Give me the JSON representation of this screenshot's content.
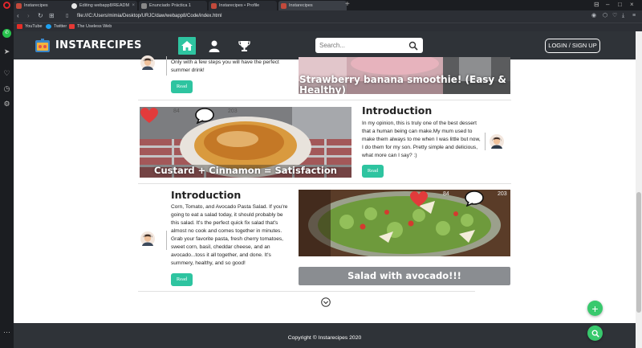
{
  "browser": {
    "tabs": [
      {
        "title": "Instarecipes"
      },
      {
        "title": "Editing webapp8/READMI"
      },
      {
        "title": "Enunciado Práctica 1"
      },
      {
        "title": "Instarecipes • Profile"
      },
      {
        "title": "Instarecipes"
      }
    ],
    "url": "file:///C:/Users/mimia/Desktop/URJC/daw/webapp8/Code/index.html",
    "bookmarks": [
      "YouTube",
      "Twitter",
      "The Useless Web"
    ]
  },
  "header": {
    "brand": "INSTARECIPES",
    "search_placeholder": "Search...",
    "login_label": "LOGIN / SIGN UP",
    "nav": [
      "home-icon",
      "user-icon",
      "trophy-icon"
    ],
    "accent_color": "#2ec4a0"
  },
  "posts": [
    {
      "blurb": "Only with a few steps you will have the perfect summer drink!",
      "read_label": "Read",
      "image_title": "Strawberry banana smoothie! (Easy & Healthy)"
    },
    {
      "likes": "84",
      "comments": "203",
      "image_title": "Custard + Cinnamon = Satisfaction",
      "heading": "Introduction",
      "blurb": "In my opinion, this is truly one of the best dessert that a human being can make.My mum used to make them always to me when I was little but now, I do them for my son. Pretty simple and delicious, what more can I say? :)",
      "read_label": "Read"
    },
    {
      "heading": "Introduction",
      "blurb": "Corn, Tomato, and Avocado Pasta Salad. If you're going to eat a salad today, it should probably be this salad. It's the perfect quick fix salad that's almost no cook and comes together in minutes. Grab your favorite pasta, fresh cherry tomatoes, sweet corn, basil, cheddar cheese, and an avocado...toss it all together, and done. It's summery, healthy, and so good!",
      "read_label": "Read",
      "likes": "84",
      "comments": "203",
      "image_title": "Salad with avocado!!!"
    }
  ],
  "footer": {
    "copyright": "Copyright © Instarecipes 2020"
  },
  "fabs": {
    "add": "+",
    "search": "search-icon"
  },
  "colors": {
    "header_bg": "#2f3338",
    "fab_green": "#38c96d",
    "heart_red": "#e23b3b"
  }
}
